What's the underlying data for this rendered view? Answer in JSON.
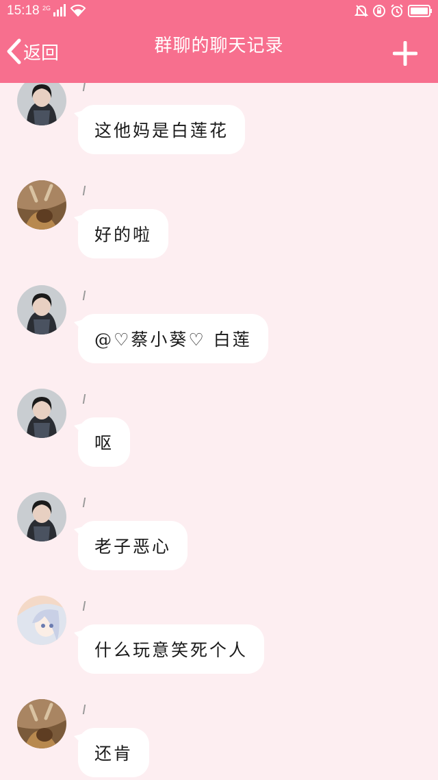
{
  "status_bar": {
    "time": "15:18",
    "network": "2G"
  },
  "header": {
    "back_label": "返回",
    "title": "群聊的聊天记录",
    "colors": {
      "bar": "#f76f8e",
      "background": "#fdeef1"
    }
  },
  "messages": [
    {
      "text": "这他妈是白莲花",
      "avatar": "girl-photo-avatar"
    },
    {
      "text": "好的啦",
      "avatar": "deer-photo-avatar"
    },
    {
      "text": "@♡蔡小葵♡ 白莲",
      "avatar": "girl-photo-avatar"
    },
    {
      "text": "呕",
      "avatar": "girl-photo-avatar"
    },
    {
      "text": "老子恶心",
      "avatar": "girl-photo-avatar"
    },
    {
      "text": "什么玩意笑死个人",
      "avatar": "anime-girl-avatar"
    },
    {
      "text": "还肯",
      "avatar": "deer-photo-avatar"
    }
  ]
}
